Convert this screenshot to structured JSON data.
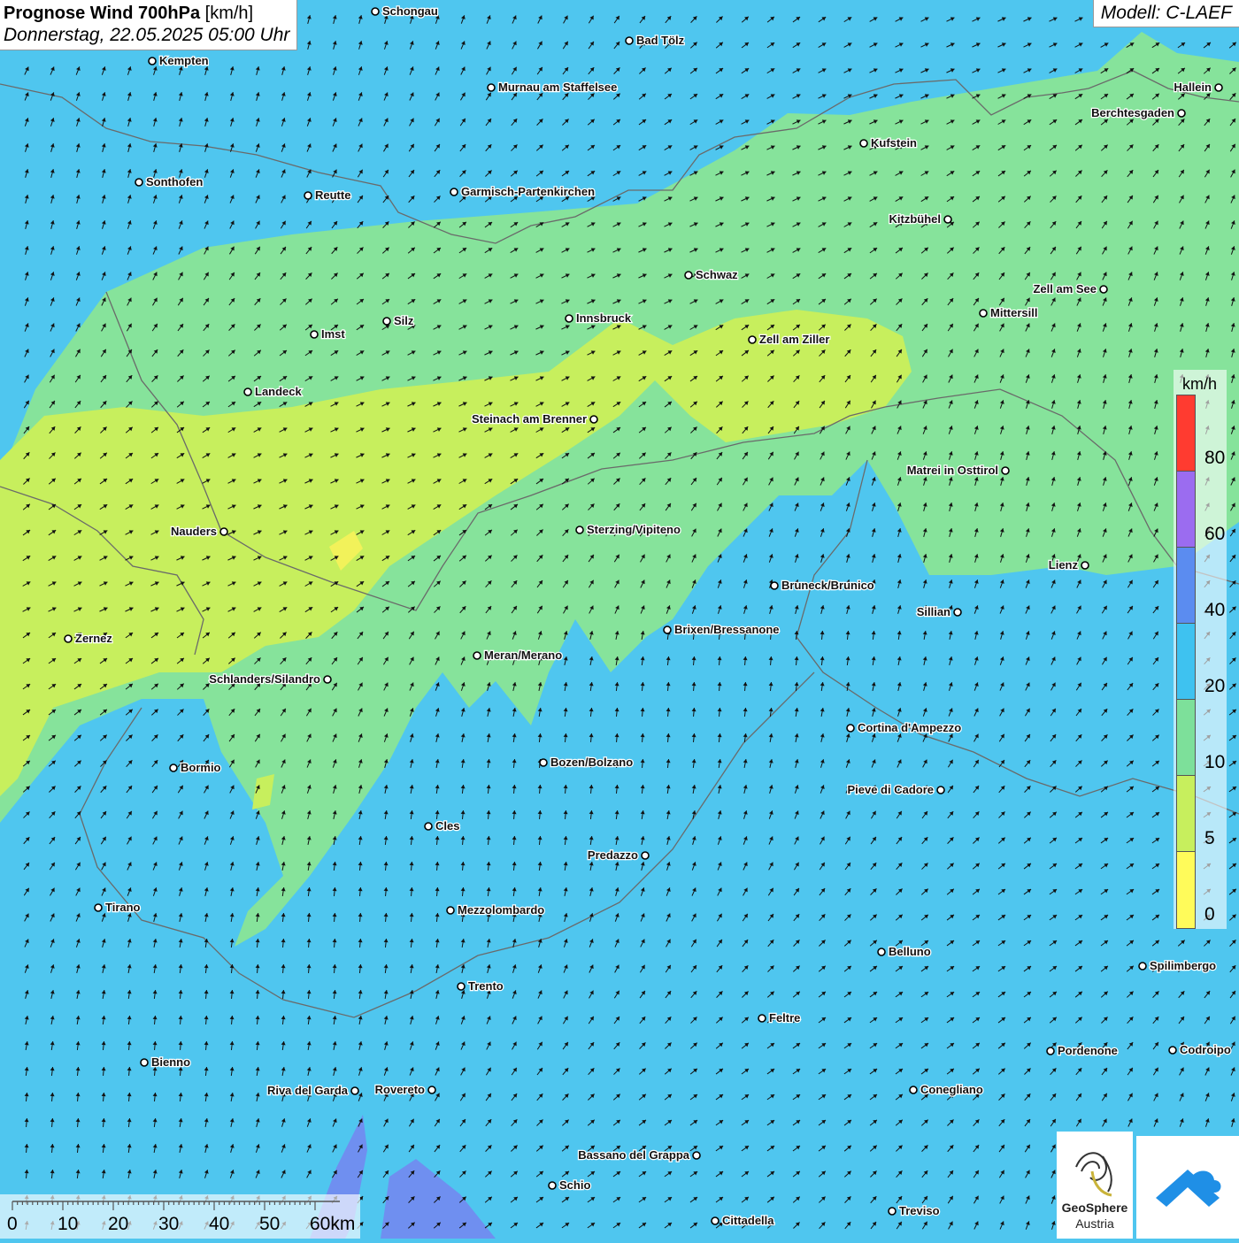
{
  "title": {
    "main": "Prognose Wind 700hPa",
    "unit": "[km/h]",
    "subtitle": "Donnerstag, 22.05.2025 05:00 Uhr"
  },
  "model": "Modell: C-LAEF",
  "legend": {
    "unit": "km/h",
    "labels": [
      "80",
      "60",
      "40",
      "20",
      "10",
      "5",
      "0"
    ],
    "colors": [
      "#ff3b30",
      "#9b6cf0",
      "#5b8cf0",
      "#3ec2f0",
      "#7de09a",
      "#c7ef5d",
      "#fffb5a"
    ]
  },
  "scale": {
    "labels": [
      "0",
      "10",
      "20",
      "30",
      "40",
      "50",
      "60km"
    ]
  },
  "logo": {
    "line1": "GeoSphere",
    "line2": "Austria"
  },
  "cities": [
    {
      "name": "Schongau"
    },
    {
      "name": "Bad Tölz"
    },
    {
      "name": "Kempten"
    },
    {
      "name": "Murnau am Staffelsee"
    },
    {
      "name": "Hallein"
    },
    {
      "name": "Berchtesgaden"
    },
    {
      "name": "Kufstein"
    },
    {
      "name": "Sonthofen"
    },
    {
      "name": "Reutte"
    },
    {
      "name": "Garmisch-Partenkirchen"
    },
    {
      "name": "Kitzbühel"
    },
    {
      "name": "Schwaz"
    },
    {
      "name": "Zell am See"
    },
    {
      "name": "Mittersill"
    },
    {
      "name": "Innsbruck"
    },
    {
      "name": "Silz"
    },
    {
      "name": "Imst"
    },
    {
      "name": "Zell am Ziller"
    },
    {
      "name": "Landeck"
    },
    {
      "name": "Steinach am Brenner"
    },
    {
      "name": "Matrei in Osttirol"
    },
    {
      "name": "Nauders"
    },
    {
      "name": "Sterzing/Vipiteno"
    },
    {
      "name": "Lienz"
    },
    {
      "name": "Bruneck/Brunico"
    },
    {
      "name": "Sillian"
    },
    {
      "name": "Zernez"
    },
    {
      "name": "Brixen/Bressanone"
    },
    {
      "name": "Meran/Merano"
    },
    {
      "name": "Schlanders/Silandro"
    },
    {
      "name": "Cortina d'Ampezzo"
    },
    {
      "name": "Bozen/Bolzano"
    },
    {
      "name": "Bormio"
    },
    {
      "name": "Pieve di Cadore"
    },
    {
      "name": "Cles"
    },
    {
      "name": "Predazzo"
    },
    {
      "name": "Tirano"
    },
    {
      "name": "Mezzolombardo"
    },
    {
      "name": "Belluno"
    },
    {
      "name": "Spilimbergo"
    },
    {
      "name": "Trento"
    },
    {
      "name": "Feltre"
    },
    {
      "name": "Pordenone"
    },
    {
      "name": "Codroipo"
    },
    {
      "name": "Bienno"
    },
    {
      "name": "Riva del Garda"
    },
    {
      "name": "Rovereto"
    },
    {
      "name": "Conegliano"
    },
    {
      "name": "Bassano del Grappa"
    },
    {
      "name": "Schio"
    },
    {
      "name": "Treviso"
    },
    {
      "name": "Cittadella"
    }
  ]
}
